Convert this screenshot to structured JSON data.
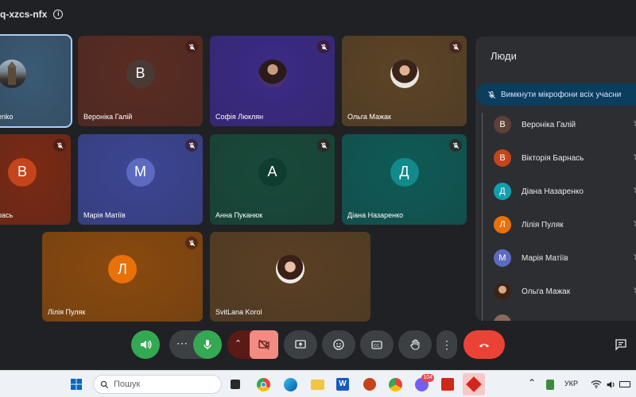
{
  "meeting": {
    "code": "q-xzcs-nfx"
  },
  "tiles": [
    {
      "name": "enko",
      "bg": "#3a5a74",
      "kind": "photo",
      "muted": false,
      "active": true
    },
    {
      "name": "Вероніка Галій",
      "bg": "#5a2c22",
      "kind": "avatar",
      "initial": "В",
      "avatar_color": "#4a3a36",
      "muted": true
    },
    {
      "name": "Софія Люклян",
      "bg": "#3b2a86",
      "kind": "photo",
      "muted": true
    },
    {
      "name": "Ольга Мажак",
      "bg": "#5c4426",
      "kind": "photo",
      "muted": true
    },
    {
      "name": "рась",
      "bg": "#7a2a14",
      "kind": "avatar",
      "initial": "В",
      "avatar_color": "#c4441c",
      "muted": true
    },
    {
      "name": "Марія Матіїв",
      "bg": "#3c4694",
      "kind": "avatar",
      "initial": "М",
      "avatar_color": "#5c6bc0",
      "muted": true
    },
    {
      "name": "Анна Пуканюк",
      "bg": "#174a3a",
      "kind": "avatar",
      "initial": "А",
      "avatar_color": "#0f3d30",
      "muted": true
    },
    {
      "name": "Діана Назаренко",
      "bg": "#0f5a56",
      "kind": "avatar",
      "initial": "Д",
      "avatar_color": "#12898a",
      "muted": true
    },
    {
      "name": "Лілія Пуляк",
      "bg": "#8a4a0e",
      "kind": "avatar",
      "initial": "Л",
      "avatar_color": "#e8710a",
      "muted": true
    },
    {
      "name": "SvitLana Korol",
      "bg": "#5a4024",
      "kind": "photo",
      "muted": false
    }
  ],
  "people_panel": {
    "title": "Люди",
    "mute_all_label": "Вимкнути мікрофони всіх учасни",
    "people": [
      {
        "name": "Вероніка Галій",
        "initial": "В",
        "color": "#5d4037"
      },
      {
        "name": "Вікторія Барнась",
        "initial": "В",
        "color": "#c4441c"
      },
      {
        "name": "Діана Назаренко",
        "initial": "Д",
        "color": "#129eaf"
      },
      {
        "name": "Лілія Пуляк",
        "initial": "Л",
        "color": "#e8710a"
      },
      {
        "name": "Марія Матіїв",
        "initial": "М",
        "color": "#5c6bc0"
      },
      {
        "name": "Ольга Мажак",
        "initial": "",
        "color": "#3a2a20"
      }
    ]
  },
  "controls": {
    "icons": [
      "volume-icon",
      "more-horizontal-icon",
      "mic-icon",
      "chevron-up-icon",
      "camera-off-icon",
      "present-icon",
      "emoji-icon",
      "captions-icon",
      "raise-hand-icon",
      "more-vertical-icon",
      "end-call-icon",
      "chat-icon"
    ],
    "accent_green": "#34a853",
    "end_call_red": "#ea4335",
    "camera_off_red": "#f28b82"
  },
  "taskbar": {
    "search_placeholder": "Пошук",
    "language": "УКР",
    "viber_badge": "104"
  }
}
